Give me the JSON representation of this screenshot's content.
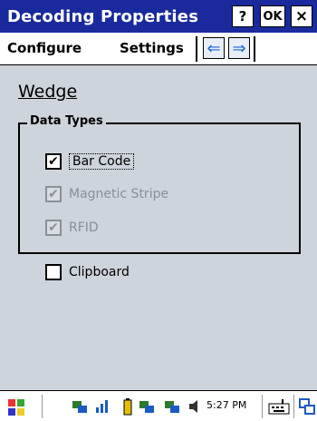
{
  "window": {
    "title": "Decoding Properties",
    "help_label": "?",
    "ok_label": "OK",
    "close_label": "×"
  },
  "menu": {
    "configure_label": "Configure",
    "settings_label": "Settings",
    "back_arrow": "⇐",
    "forward_arrow": "⇒"
  },
  "main": {
    "heading": "Wedge",
    "group_title": "Data Types",
    "options": [
      {
        "label": "Bar Code",
        "checked": true,
        "enabled": true,
        "mark": "✔"
      },
      {
        "label": "Magnetic Stripe",
        "checked": true,
        "enabled": false,
        "mark": "✔"
      },
      {
        "label": "RFID",
        "checked": true,
        "enabled": false,
        "mark": "✔"
      }
    ],
    "clipboard": {
      "label": "Clipboard",
      "checked": false,
      "mark": ""
    }
  },
  "taskbar": {
    "start_icon": "windows-flag-icon",
    "clock": "5:27 PM",
    "colors": {
      "title_bar": "#1a2a9c",
      "panel": "#cdd4db",
      "disabled": "#8a9097"
    }
  }
}
